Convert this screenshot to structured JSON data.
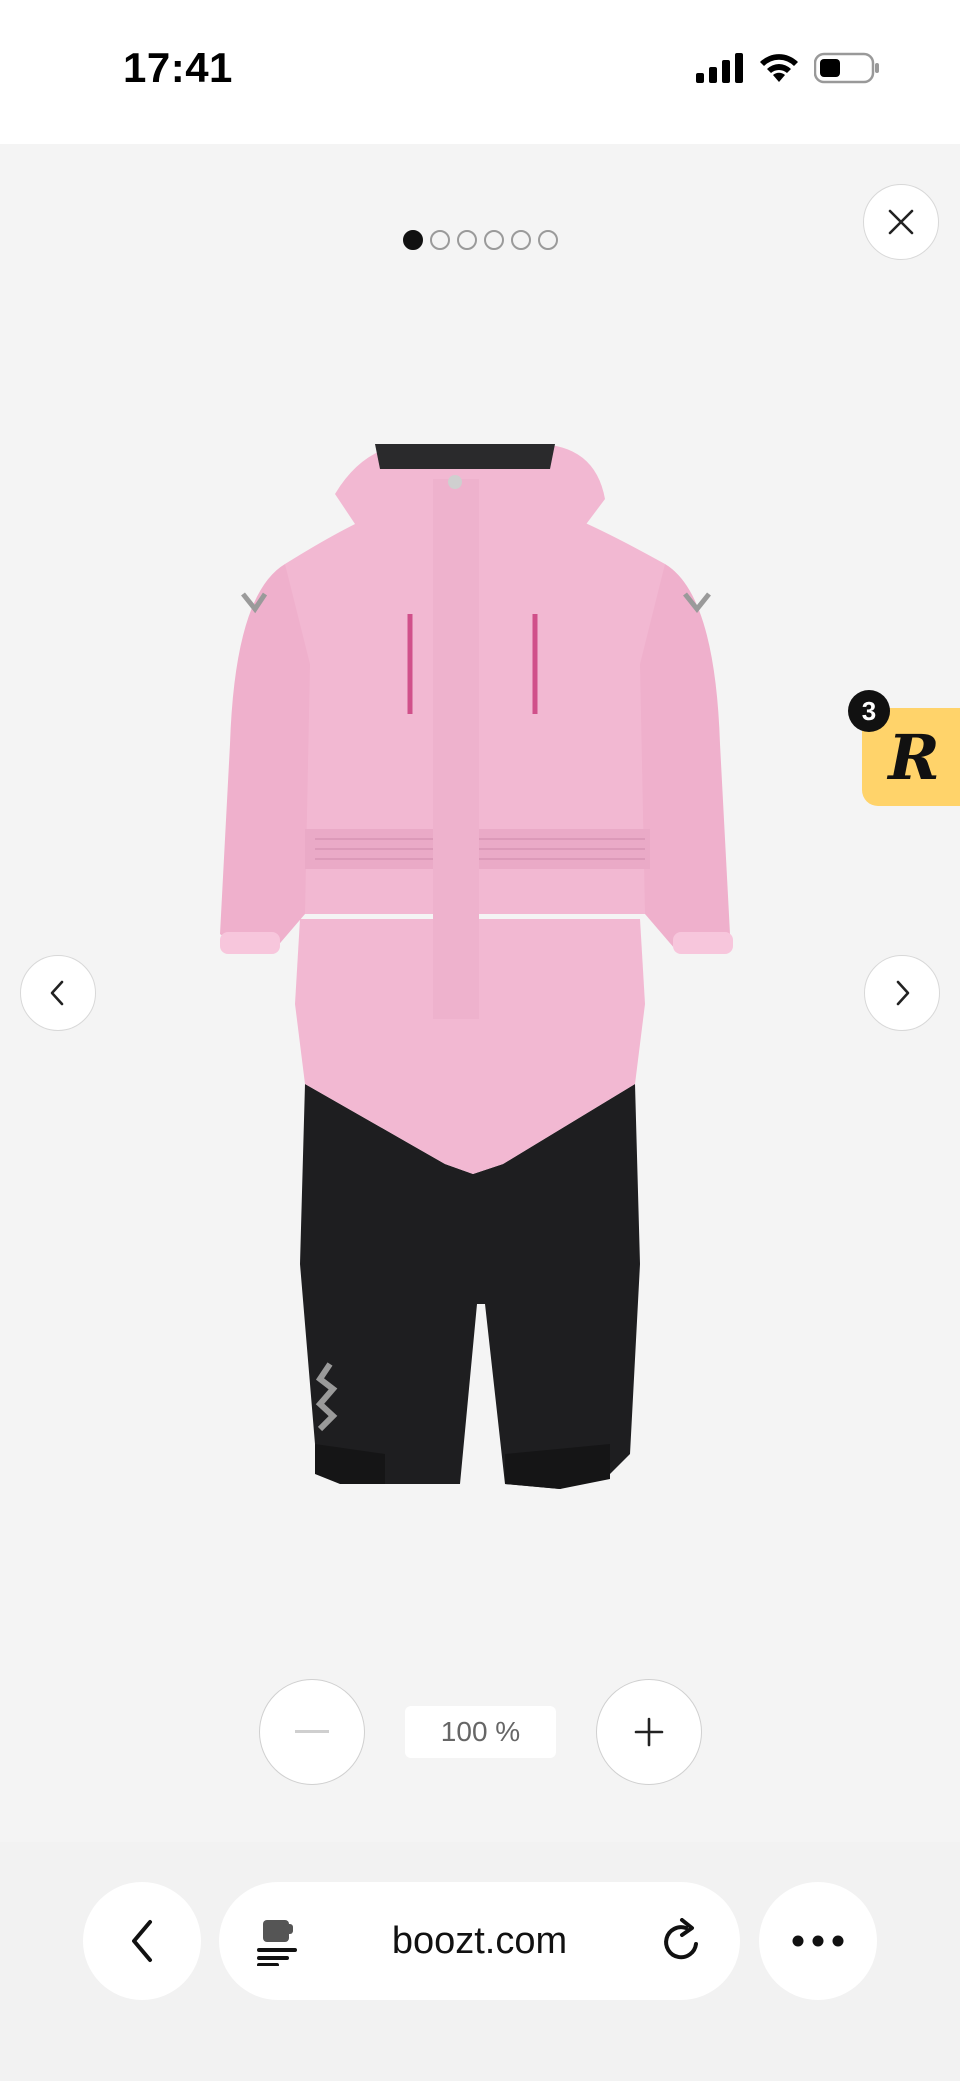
{
  "status_bar": {
    "time": "17:41"
  },
  "gallery": {
    "image_count": 6,
    "active_index": 0,
    "product_image": "pink-and-black-kids-snowsuit",
    "close_icon": "close-icon",
    "prev_icon": "chevron-left-icon",
    "next_icon": "chevron-right-icon"
  },
  "badge": {
    "count": "3",
    "letter": "R",
    "color": "#ffd36a"
  },
  "zoom": {
    "level": "100 %",
    "minus_icon": "minus-icon",
    "plus_icon": "plus-icon"
  },
  "browser": {
    "url": "boozt.com",
    "site_icon": "page-settings-icon",
    "reload_icon": "reload-icon",
    "back_icon": "chevron-left-icon",
    "more_icon": "more-dots-icon"
  },
  "colors": {
    "suit_pink": "#f2b8d2",
    "suit_black": "#1e1e20",
    "background": "#f4f4f4"
  }
}
